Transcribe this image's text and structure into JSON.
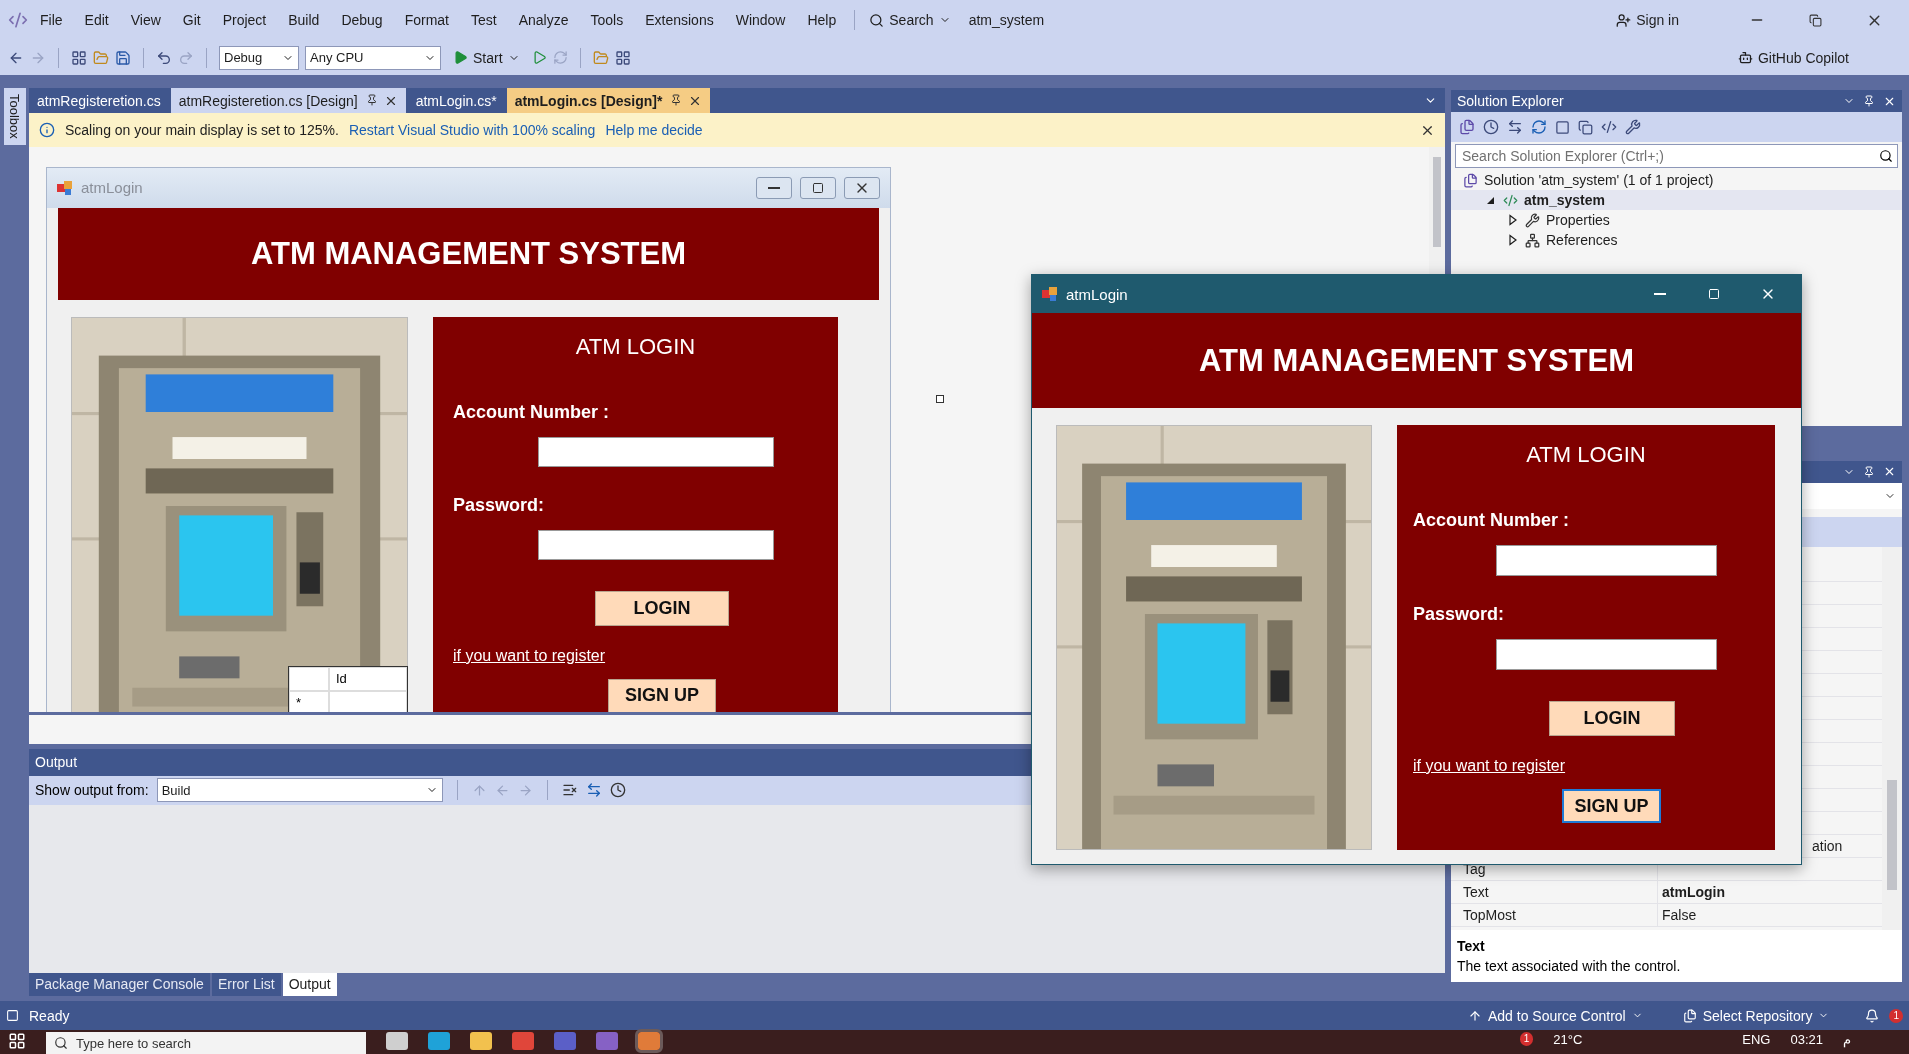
{
  "menu_bar": {
    "items": [
      "File",
      "Edit",
      "View",
      "Git",
      "Project",
      "Build",
      "Debug",
      "Format",
      "Test",
      "Analyze",
      "Tools",
      "Extensions",
      "Window",
      "Help"
    ],
    "search": "Search",
    "solution_name": "atm_system",
    "sign_in": "Sign in"
  },
  "toolbar": {
    "configuration": "Debug",
    "platform": "Any CPU",
    "start": "Start",
    "copilot": "GitHub Copilot"
  },
  "toolbox_tab": "Toolbox",
  "document_tabs": [
    {
      "label": "atmRegisteretion.cs",
      "selected": false,
      "highlighted": false
    },
    {
      "label": "atmRegisteretion.cs [Design]",
      "selected": false,
      "highlighted": true
    },
    {
      "label": "atmLogin.cs*",
      "selected": false,
      "highlighted": false
    },
    {
      "label": "atmLogin.cs [Design]*",
      "selected": true,
      "highlighted": false
    }
  ],
  "info_bar": {
    "message": "Scaling on your main display is set to 125%.",
    "links": [
      "Restart Visual Studio with 100% scaling",
      "Help me decide"
    ]
  },
  "designer_form": {
    "kind": "designer",
    "title": "atmLogin",
    "header": "ATM MANAGEMENT SYSTEM",
    "panel_title": "ATM LOGIN",
    "account_label": "Account Number :",
    "password_label": "Password:",
    "login_button": "LOGIN",
    "register_link": "if you want to register",
    "signup_button": "SIGN UP",
    "signup_focused": false,
    "grid": {
      "column": "Id",
      "new_row": "*"
    }
  },
  "running_window": {
    "kind": "running",
    "title": "atmLogin",
    "header": "ATM MANAGEMENT SYSTEM",
    "panel_title": "ATM LOGIN",
    "account_label": "Account Number :",
    "password_label": "Password:",
    "login_button": "LOGIN",
    "register_link": "if you want to register",
    "signup_button": "SIGN UP",
    "signup_focused": true
  },
  "output": {
    "title": "Output",
    "show_from_label": "Show output from:",
    "source": "Build"
  },
  "bottom_tabs": [
    {
      "label": "Package Manager Console",
      "selected": false
    },
    {
      "label": "Error List",
      "selected": false
    },
    {
      "label": "Output",
      "selected": true
    }
  ],
  "solution_explorer": {
    "title": "Solution Explorer",
    "search_placeholder": "Search Solution Explorer (Ctrl+;)",
    "tree": [
      {
        "label": "Solution 'atm_system' (1 of 1 project)",
        "kind": "solution",
        "selected": false,
        "children": [
          {
            "label": "atm_system",
            "kind": "project",
            "selected": true,
            "expanded": true,
            "children": [
              {
                "label": "Properties",
                "kind": "properties",
                "selected": false,
                "expanded": false
              },
              {
                "label": "References",
                "kind": "references",
                "selected": false,
                "expanded": false
              }
            ]
          }
        ]
      }
    ]
  },
  "properties": {
    "rows": [
      {
        "kind": "tail",
        "value": "ation"
      },
      {
        "kind": "full",
        "name": "Tag"
      },
      {
        "kind": "full",
        "name": "Text",
        "value": "atmLogin",
        "modified": true
      },
      {
        "kind": "full",
        "name": "TopMost",
        "value": "False",
        "modified": false
      }
    ],
    "description_title": "Text",
    "description": "The text associated with the control."
  },
  "status_bar": {
    "status": "Ready",
    "source_control": "Add to Source Control",
    "repository": "Select Repository",
    "notifications": "1"
  },
  "taskbar": {
    "search_placeholder": "Type here to search",
    "weather_badge": "1",
    "temperature": "21°C",
    "language": "ENG",
    "time": "03:21",
    "period": "م"
  }
}
